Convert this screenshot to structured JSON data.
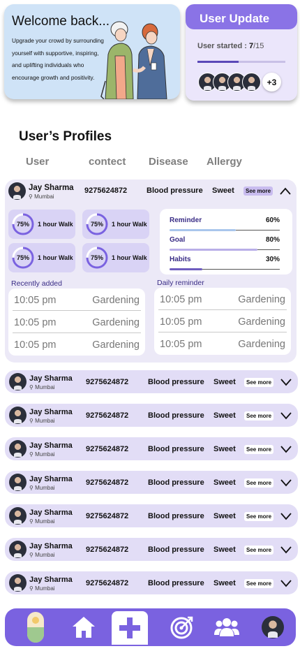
{
  "welcome": {
    "title": "Welcome back...",
    "text": "Upgrade your crowd by surrounding yourself with supportive, inspiring, and uplifting individuals who encourage growth and positivity."
  },
  "update": {
    "title": "User Update",
    "started_label": "User started :",
    "started_count": "7",
    "started_total": "/15",
    "progress": 0.47,
    "more_count": "+3"
  },
  "profiles": {
    "title": "User’s Profiles",
    "columns": [
      "User",
      "contect",
      "Disease",
      "Allergy"
    ]
  },
  "expanded": {
    "name": "Jay Sharma",
    "location": "Mumbai",
    "phone": "9275624872",
    "disease": "Blood pressure",
    "allergy": "Sweet",
    "see_more": "See more",
    "walks": [
      {
        "percent": "75%",
        "value": 0.75,
        "label": "1 hour Walk"
      },
      {
        "percent": "75%",
        "value": 0.75,
        "label": "1 hour Walk"
      },
      {
        "percent": "75%",
        "value": 0.75,
        "label": "1 hour Walk"
      },
      {
        "percent": "75%",
        "value": 0.75,
        "label": "1 hour Walk"
      }
    ],
    "metrics": [
      {
        "label": "Reminder",
        "value": "60%",
        "fraction": 0.6,
        "color": "#a9c6ec"
      },
      {
        "label": "Goal",
        "value": "80%",
        "fraction": 0.8,
        "color": "#b9aee8"
      },
      {
        "label": "Habits",
        "value": "30%",
        "fraction": 0.3,
        "color": "#6e5cbf"
      }
    ],
    "recent_label": "Recently added",
    "daily_label": "Daily reminder",
    "recent": [
      {
        "time": "10:05  pm",
        "activity": "Gardening"
      },
      {
        "time": "10:05  pm",
        "activity": "Gardening"
      },
      {
        "time": "10:05  pm",
        "activity": "Gardening"
      }
    ],
    "daily": [
      {
        "time": "10:05  pm",
        "activity": "Gardening"
      },
      {
        "time": "10:05  pm",
        "activity": "Gardening"
      },
      {
        "time": "10:05  pm",
        "activity": "Gardening"
      }
    ]
  },
  "rows": [
    {
      "name": "Jay Sharma",
      "location": "Mumbai",
      "phone": "9275624872",
      "disease": "Blood pressure",
      "allergy": "Sweet",
      "see_more": "See more"
    },
    {
      "name": "Jay Sharma",
      "location": "Mumbai",
      "phone": "9275624872",
      "disease": "Blood pressure",
      "allergy": "Sweet",
      "see_more": "See more"
    },
    {
      "name": "Jay Sharma",
      "location": "Mumbai",
      "phone": "9275624872",
      "disease": "Blood pressure",
      "allergy": "Sweet",
      "see_more": "See more"
    },
    {
      "name": "Jay Sharma",
      "location": "Mumbai",
      "phone": "9275624872",
      "disease": "Blood pressure",
      "allergy": "Sweet",
      "see_more": "See more"
    },
    {
      "name": "Jay Sharma",
      "location": "Mumbai",
      "phone": "9275624872",
      "disease": "Blood pressure",
      "allergy": "Sweet",
      "see_more": "See more"
    },
    {
      "name": "Jay Sharma",
      "location": "Mumbai",
      "phone": "9275624872",
      "disease": "Blood pressure",
      "allergy": "Sweet",
      "see_more": "See more"
    },
    {
      "name": "Jay Sharma",
      "location": "Mumbai",
      "phone": "9275624872",
      "disease": "Blood pressure",
      "allergy": "Sweet",
      "see_more": "See more"
    }
  ],
  "nav": {
    "items": [
      "pill-icon",
      "home-icon",
      "plus-icon",
      "target-icon",
      "users-icon",
      "avatar"
    ]
  },
  "colors": {
    "accent": "#7a62e0",
    "card_bg": "#ece9f7",
    "row_bg": "#e2ddf6",
    "welcome_bg": "#cfe3f7"
  }
}
